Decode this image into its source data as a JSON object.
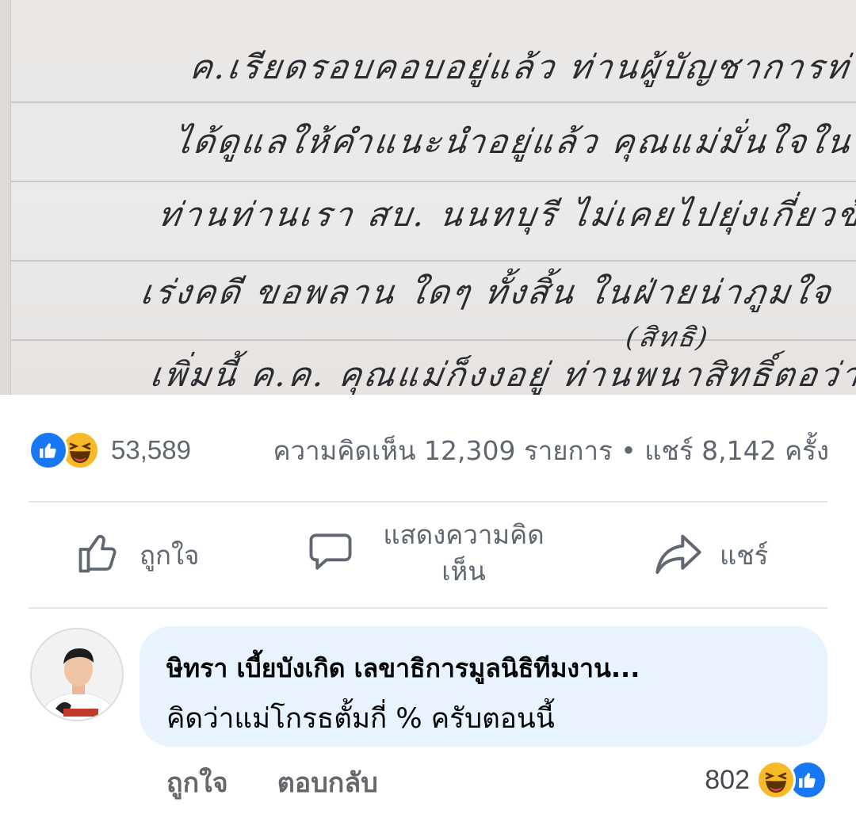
{
  "post": {
    "note_lines": [
      "ค.เรียดรอบคอบอยู่แล้ว ท่านผู้บัญชาการท่าน",
      "ได้ดูแลให้คำแนะนำอยู่แล้ว คุณแม่มั่นใจใน",
      "ท่านท่านเรา สบ. นนทบุรี ไม่เคยไปยุ่งเกี่ยวข้อง",
      "เร่งคดี ขอพลาน ใดๆ ทั้งสิ้น ในฝ่ายน่าภูมใจ",
      "เพิ่มนี้ ค.ค. คุณแม่ก็งงอยู่ ท่านพนาสิทธิ์ตอว่า",
      "(สิทธิ)"
    ],
    "reaction_count": "53,589",
    "meta_stats": "ความคิดเห็น 12,309 รายการ • แชร์ 8,142 ครั้ง"
  },
  "actions": {
    "like_label": "ถูกใจ",
    "comment_label": "แสดงความคิด เห็น",
    "share_label": "แชร์"
  },
  "comment": {
    "author": "ษิทรา เบี้ยบังเกิด เลขาธิการมูลนิธิทีมงาน...",
    "text": "คิดว่าแม่โกรธตั้มกี่ % ครับตอนนี้",
    "like_label": "ถูกใจ",
    "reply_label": "ตอบกลับ",
    "reaction_count": "802"
  },
  "icons": {
    "like_reaction": "like-reaction-icon",
    "haha_reaction": "haha-reaction-icon",
    "like": "thumbs-up-icon",
    "comment": "speech-bubble-icon",
    "share": "share-arrow-icon"
  },
  "colors": {
    "facebook_blue": "#1877f2",
    "haha_yellow": "#f7b928",
    "comment_bubble": "#e7f3ff",
    "secondary_text": "#606770"
  }
}
